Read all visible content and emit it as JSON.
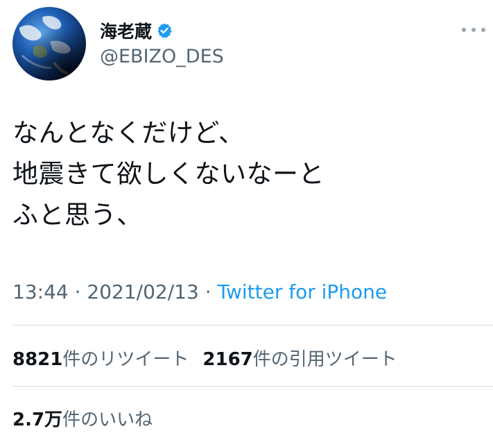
{
  "author": {
    "display_name": "海老蔵",
    "handle": "@EBIZO_DES",
    "verified": true,
    "verified_badge_color": "#1d9bf0",
    "avatar_icon": "earth-globe-avatar"
  },
  "more_menu_icon": "more-horizontal-icon",
  "tweet": {
    "lines": [
      "なんとなくだけど、",
      "地震きて欲しくないなーと",
      "ふと思う、"
    ]
  },
  "meta": {
    "time": "13:44",
    "separator1": " · ",
    "date": "2021/02/13",
    "separator2": " · ",
    "source": "Twitter for iPhone",
    "source_color": "#1d9bf0"
  },
  "stats": {
    "retweets_count": "8821",
    "retweets_label": "件のリツイート",
    "quotes_count": "2167",
    "quotes_label": "件の引用ツイート",
    "likes_count": "2.7万",
    "likes_label": "件のいいね"
  }
}
